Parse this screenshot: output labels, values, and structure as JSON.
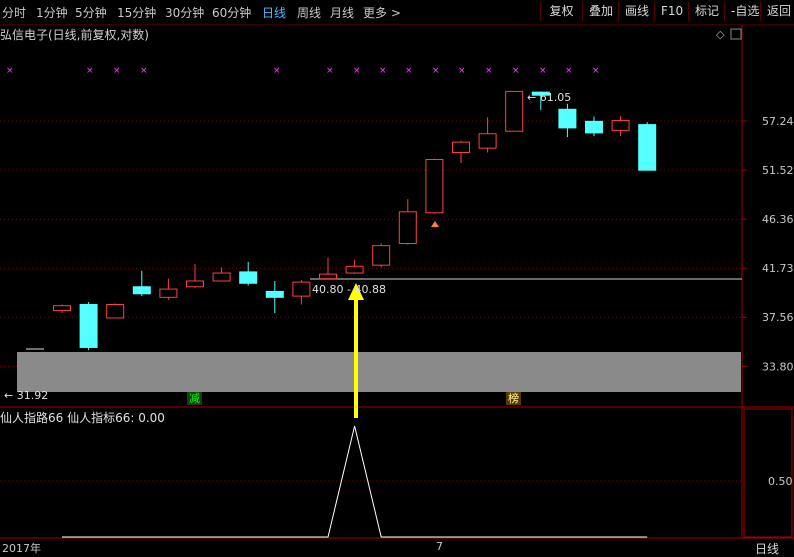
{
  "toolbar": {
    "tabs": [
      "分时",
      "1分钟",
      "5分钟",
      "15分钟",
      "30分钟",
      "60分钟",
      "日线",
      "周线",
      "月线",
      "更多 >"
    ],
    "active_tab": "日线",
    "buttons": [
      "复权",
      "叠加",
      "画线",
      "F10",
      "标记",
      "-自选",
      "返回"
    ]
  },
  "chart": {
    "title": "弘信电子(日线,前复权,对数)",
    "price_ticks": [
      "57.24",
      "51.52",
      "46.36",
      "41.73",
      "37.56",
      "33.80"
    ],
    "price_marker": "40.80 - 40.88",
    "high_label": "61.05",
    "low_label": "31.92",
    "tag_jian": "减",
    "tag_bang": "榜"
  },
  "indicator": {
    "label": "仙人指路66  仙人指标66: 0.00",
    "tick": "0.50"
  },
  "xaxis": {
    "left": "2017年",
    "mid": "7",
    "right": "日线"
  },
  "colors": {
    "up": "#ff4040",
    "down": "#54ffff",
    "grid": "#7a0000",
    "arrow": "#ffff00",
    "marker": "#ff40ff"
  },
  "chart_data": {
    "type": "candlestick",
    "scale": "log",
    "ylim": [
      31.92,
      61.05
    ],
    "candles": [
      {
        "open": 38.1,
        "close": 38.5,
        "high": 38.6,
        "low": 37.9
      },
      {
        "open": 38.6,
        "close": 35.2,
        "high": 38.8,
        "low": 35.0
      },
      {
        "open": 37.5,
        "close": 38.6,
        "high": 38.7,
        "low": 37.5
      },
      {
        "open": 40.1,
        "close": 39.5,
        "high": 41.5,
        "low": 39.3
      },
      {
        "open": 39.2,
        "close": 39.9,
        "high": 40.8,
        "low": 39.0
      },
      {
        "open": 40.1,
        "close": 40.6,
        "high": 42.1,
        "low": 40.0
      },
      {
        "open": 40.6,
        "close": 41.3,
        "high": 41.8,
        "low": 40.6
      },
      {
        "open": 41.4,
        "close": 40.4,
        "high": 42.3,
        "low": 40.2
      },
      {
        "open": 39.7,
        "close": 39.2,
        "high": 40.6,
        "low": 37.9
      },
      {
        "open": 39.3,
        "close": 40.5,
        "high": 40.7,
        "low": 38.6
      },
      {
        "open": 40.8,
        "close": 41.2,
        "high": 42.7,
        "low": 40.8
      },
      {
        "open": 41.3,
        "close": 41.9,
        "high": 42.5,
        "low": 41.2
      },
      {
        "open": 42.0,
        "close": 43.8,
        "high": 44.0,
        "low": 41.8
      },
      {
        "open": 44.0,
        "close": 47.1,
        "high": 48.4,
        "low": 43.9
      },
      {
        "open": 47.0,
        "close": 52.7,
        "high": 52.8,
        "low": 46.9
      },
      {
        "open": 53.5,
        "close": 54.7,
        "high": 54.9,
        "low": 52.3
      },
      {
        "open": 54.0,
        "close": 55.7,
        "high": 57.7,
        "low": 53.5
      },
      {
        "open": 56.0,
        "close": 61.0,
        "high": 61.05,
        "low": 56.0
      },
      {
        "open": 60.9,
        "close": 60.5,
        "high": 61.0,
        "low": 58.6
      },
      {
        "open": 58.7,
        "close": 56.4,
        "high": 59.4,
        "low": 55.3
      },
      {
        "open": 57.2,
        "close": 55.8,
        "high": 57.8,
        "low": 55.4
      },
      {
        "open": 56.1,
        "close": 57.3,
        "high": 57.9,
        "low": 55.4
      },
      {
        "open": 56.8,
        "close": 51.5,
        "high": 57.1,
        "low": 51.5
      }
    ],
    "indicator_values": [
      0,
      0,
      0,
      0,
      0,
      0,
      0,
      0,
      0,
      0,
      0,
      1,
      0,
      0,
      0,
      0,
      0,
      0,
      0,
      0,
      0,
      0,
      0
    ]
  }
}
